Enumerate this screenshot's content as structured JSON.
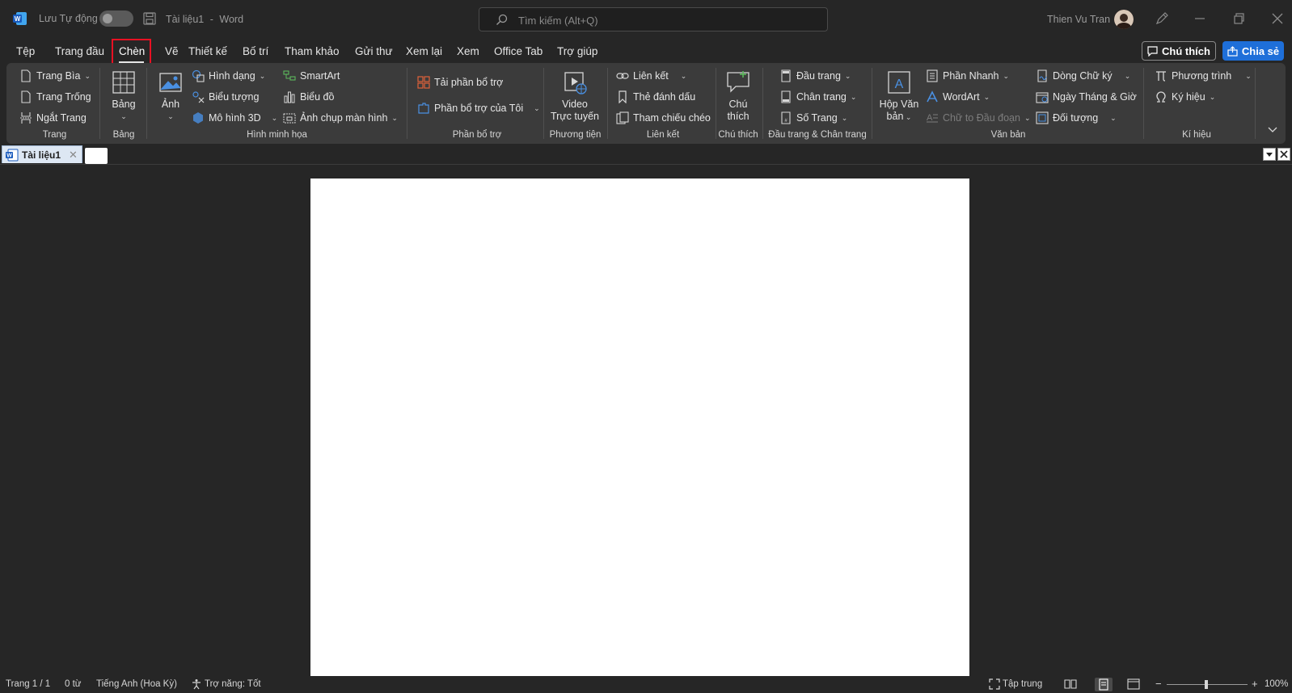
{
  "titlebar": {
    "autosave_label": "Lưu Tự động",
    "doc_title": "Tài liệu1",
    "separator": "-",
    "app_name": "Word",
    "search_placeholder": "Tìm kiếm (Alt+Q)",
    "user_name": "Thien Vu Tran"
  },
  "menu": {
    "tabs": [
      "Tệp",
      "Trang đầu",
      "Chèn",
      "Vẽ",
      "Thiết kế",
      "Bố trí",
      "Tham khảo",
      "Gửi thư",
      "Xem lại",
      "Xem",
      "Office Tab",
      "Trợ giúp"
    ],
    "active_tab": "Chèn",
    "comment_button": "Chú thích",
    "share_button": "Chia sẻ"
  },
  "ribbon": {
    "trang": {
      "items": [
        "Trang Bìa",
        "Trang Trống",
        "Ngắt Trang"
      ],
      "label": "Trang"
    },
    "bang": {
      "button": "Bảng",
      "label": "Bảng"
    },
    "hinh_minh_hoa": {
      "anh": "Ảnh",
      "items": [
        "Hình dạng",
        "Biểu tượng",
        "Mô hình 3D",
        "SmartArt",
        "Biểu đồ",
        "Ảnh chụp màn hình"
      ],
      "label": "Hình minh họa"
    },
    "phan_bo_tro": {
      "items": [
        "Tải phần bổ trợ",
        "Phần bổ trợ của Tôi"
      ],
      "label": "Phần bổ trợ"
    },
    "phuong_tien": {
      "button_line1": "Video",
      "button_line2": "Trực tuyến",
      "label": "Phương tiện"
    },
    "lien_ket": {
      "items": [
        "Liên kết",
        "Thẻ đánh dấu",
        "Tham chiếu chéo"
      ],
      "label": "Liên kết"
    },
    "chu_thich": {
      "button_line1": "Chú",
      "button_line2": "thích",
      "label": "Chú thích"
    },
    "dau_trang": {
      "items": [
        "Đầu trang",
        "Chân trang",
        "Số Trang"
      ],
      "label": "Đầu trang & Chân trang"
    },
    "van_ban": {
      "hop_line1": "Hộp Văn",
      "hop_line2": "bản",
      "items": [
        "Phần Nhanh",
        "WordArt",
        "Chữ to Đầu đoạn",
        "Dòng Chữ ký",
        "Ngày Tháng & Giờ",
        "Đối tượng"
      ],
      "label": "Văn bản"
    },
    "ki_hieu": {
      "items": [
        "Phương trình",
        "Ký hiệu"
      ],
      "label": "Kí hiệu"
    }
  },
  "doctabs": {
    "tab_title": "Tài liệu1"
  },
  "statusbar": {
    "page": "Trang 1 / 1",
    "words": "0 từ",
    "language": "Tiếng Anh (Hoa Kỳ)",
    "accessibility": "Trợ năng: Tốt",
    "focus": "Tập trung",
    "zoom": "100%"
  },
  "colors": {
    "accent_blue": "#1e6fd9",
    "highlight_red": "#e81123",
    "background": "#262626",
    "ribbon": "#3b3b3b"
  },
  "icons": [
    "word-logo-icon",
    "save-icon",
    "search-icon",
    "pen-icon",
    "minimize-icon",
    "restore-icon",
    "close-icon",
    "comment-icon",
    "share-icon"
  ]
}
